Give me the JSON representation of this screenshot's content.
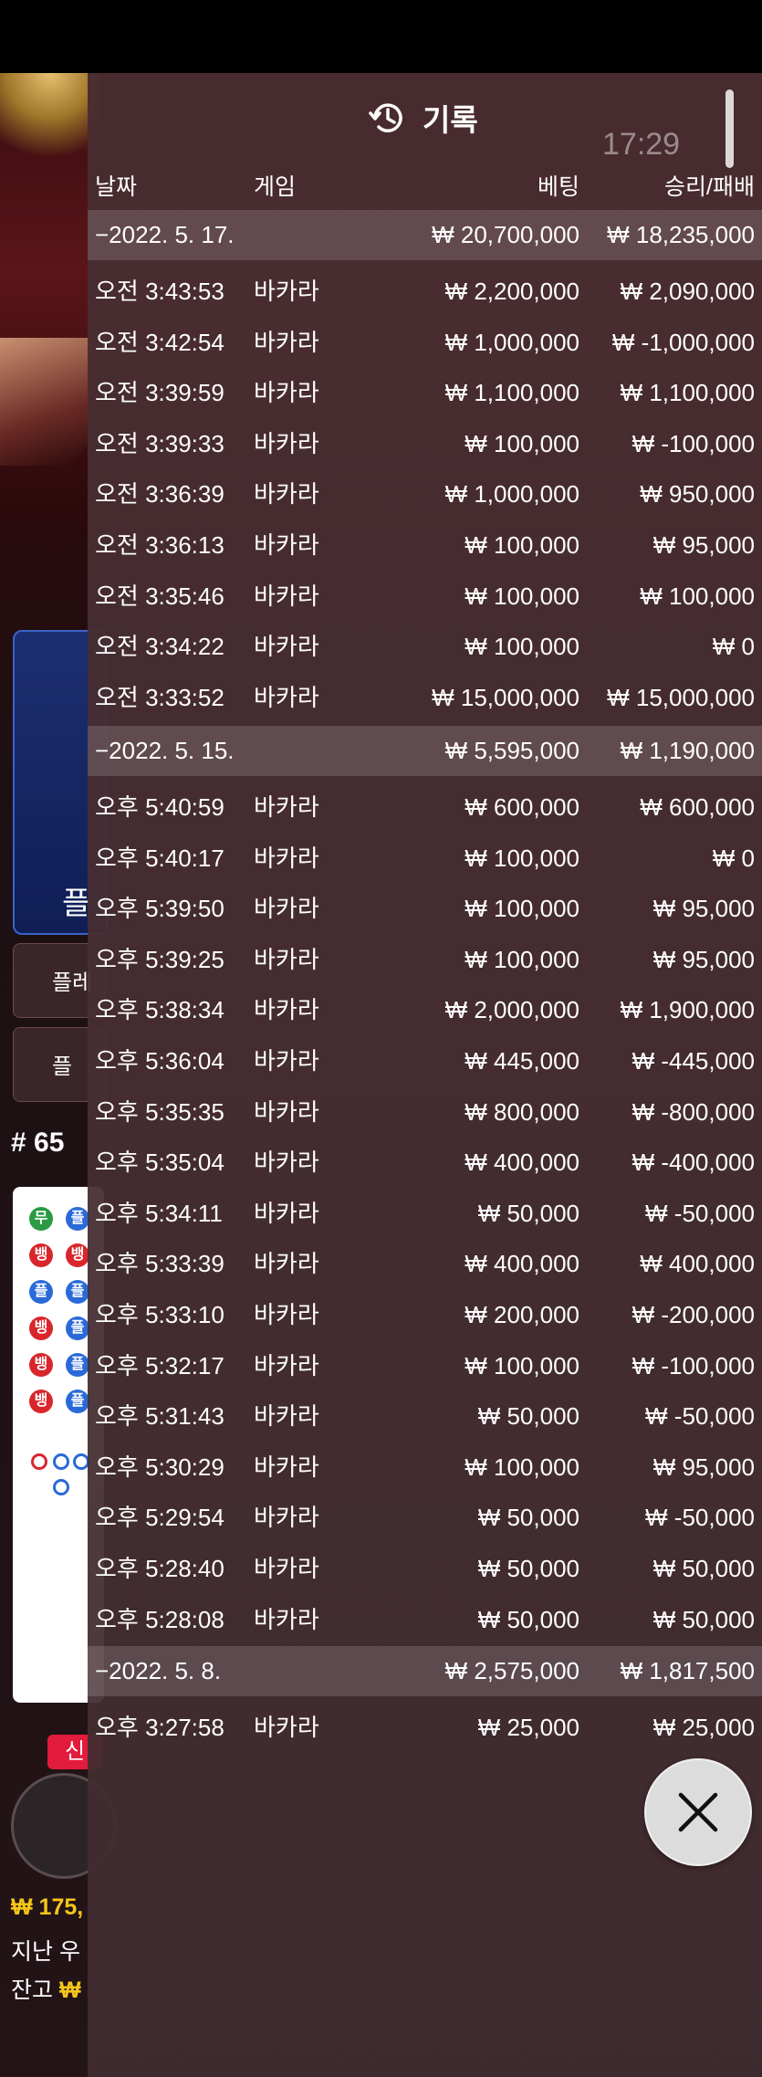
{
  "status": {
    "time": "17:29"
  },
  "header": {
    "title": "기록",
    "icon": "history-icon"
  },
  "columns": {
    "date": "날짜",
    "game": "게임",
    "bet": "베팅",
    "result": "승리/패배"
  },
  "groups": [
    {
      "date": "−2022. 5. 17.",
      "bet_total": "₩ 20,700,000",
      "result_total": "₩ 18,235,000",
      "rows": [
        {
          "time": "오전 3:43:53",
          "game": "바카라",
          "bet": "₩ 2,200,000",
          "result": "₩ 2,090,000"
        },
        {
          "time": "오전 3:42:54",
          "game": "바카라",
          "bet": "₩ 1,000,000",
          "result": "₩ -1,000,000"
        },
        {
          "time": "오전 3:39:59",
          "game": "바카라",
          "bet": "₩ 1,100,000",
          "result": "₩ 1,100,000"
        },
        {
          "time": "오전 3:39:33",
          "game": "바카라",
          "bet": "₩ 100,000",
          "result": "₩ -100,000"
        },
        {
          "time": "오전 3:36:39",
          "game": "바카라",
          "bet": "₩ 1,000,000",
          "result": "₩ 950,000"
        },
        {
          "time": "오전 3:36:13",
          "game": "바카라",
          "bet": "₩ 100,000",
          "result": "₩ 95,000"
        },
        {
          "time": "오전 3:35:46",
          "game": "바카라",
          "bet": "₩ 100,000",
          "result": "₩ 100,000"
        },
        {
          "time": "오전 3:34:22",
          "game": "바카라",
          "bet": "₩ 100,000",
          "result": "₩ 0"
        },
        {
          "time": "오전 3:33:52",
          "game": "바카라",
          "bet": "₩ 15,000,000",
          "result": "₩ 15,000,000"
        }
      ]
    },
    {
      "date": "−2022. 5. 15.",
      "bet_total": "₩ 5,595,000",
      "result_total": "₩ 1,190,000",
      "rows": [
        {
          "time": "오후 5:40:59",
          "game": "바카라",
          "bet": "₩ 600,000",
          "result": "₩ 600,000"
        },
        {
          "time": "오후 5:40:17",
          "game": "바카라",
          "bet": "₩ 100,000",
          "result": "₩ 0"
        },
        {
          "time": "오후 5:39:50",
          "game": "바카라",
          "bet": "₩ 100,000",
          "result": "₩ 95,000"
        },
        {
          "time": "오후 5:39:25",
          "game": "바카라",
          "bet": "₩ 100,000",
          "result": "₩ 95,000"
        },
        {
          "time": "오후 5:38:34",
          "game": "바카라",
          "bet": "₩ 2,000,000",
          "result": "₩ 1,900,000"
        },
        {
          "time": "오후 5:36:04",
          "game": "바카라",
          "bet": "₩ 445,000",
          "result": "₩ -445,000"
        },
        {
          "time": "오후 5:35:35",
          "game": "바카라",
          "bet": "₩ 800,000",
          "result": "₩ -800,000"
        },
        {
          "time": "오후 5:35:04",
          "game": "바카라",
          "bet": "₩ 400,000",
          "result": "₩ -400,000"
        },
        {
          "time": "오후 5:34:11",
          "game": "바카라",
          "bet": "₩ 50,000",
          "result": "₩ -50,000"
        },
        {
          "time": "오후 5:33:39",
          "game": "바카라",
          "bet": "₩ 400,000",
          "result": "₩ 400,000"
        },
        {
          "time": "오후 5:33:10",
          "game": "바카라",
          "bet": "₩ 200,000",
          "result": "₩ -200,000"
        },
        {
          "time": "오후 5:32:17",
          "game": "바카라",
          "bet": "₩ 100,000",
          "result": "₩ -100,000"
        },
        {
          "time": "오후 5:31:43",
          "game": "바카라",
          "bet": "₩ 50,000",
          "result": "₩ -50,000"
        },
        {
          "time": "오후 5:30:29",
          "game": "바카라",
          "bet": "₩ 100,000",
          "result": "₩ 95,000"
        },
        {
          "time": "오후 5:29:54",
          "game": "바카라",
          "bet": "₩ 50,000",
          "result": "₩ -50,000"
        },
        {
          "time": "오후 5:28:40",
          "game": "바카라",
          "bet": "₩ 50,000",
          "result": "₩ 50,000"
        },
        {
          "time": "오후 5:28:08",
          "game": "바카라",
          "bet": "₩ 50,000",
          "result": "₩ 50,000"
        }
      ]
    },
    {
      "date": "−2022. 5. 8.",
      "bet_total": "₩ 2,575,000",
      "result_total": "₩ 1,817,500",
      "rows": [
        {
          "time": "오후 3:27:58",
          "game": "바카라",
          "bet": "₩ 25,000",
          "result": "₩ 25,000"
        }
      ]
    }
  ],
  "background": {
    "blue_label": "플",
    "btn1": "플레",
    "btn2": "플",
    "round": "# 65",
    "new_badge": "신",
    "bead_labels": {
      "tie": "무",
      "banker": "뱅",
      "player": "플"
    },
    "footer_amount": "₩ 175,",
    "footer_last_win": "지난 우",
    "footer_balance_label": "잔고",
    "footer_balance_amount": "₩"
  },
  "close_icon": "close-icon",
  "colors": {
    "panel": "#4a2e32",
    "date_row": "#6a5054",
    "text": "#ffffff",
    "gold": "#f5c518"
  }
}
